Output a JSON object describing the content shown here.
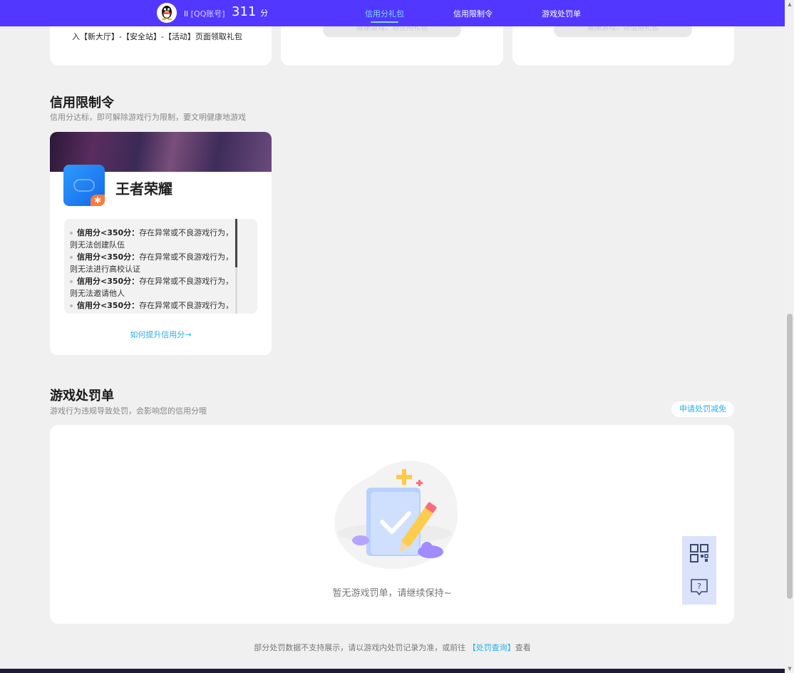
{
  "header": {
    "account_prefix": "ll",
    "account_label": "[QQ账号]",
    "score": "311",
    "score_unit": "分",
    "nav": [
      {
        "label": "信用分礼包",
        "active": true
      },
      {
        "label": "信用限制令",
        "active": false
      },
      {
        "label": "游戏处罚单",
        "active": false
      }
    ]
  },
  "top_cards": {
    "card1_text": "入【新大厅】-【安全站】-【活动】页面领取礼包",
    "card2_button": "健康游戏，领信用礼包",
    "card3_button": "健康游戏，领信用礼包"
  },
  "restriction": {
    "title": "信用限制令",
    "subtitle": "信用分达标，即可解除游戏行为限制，要文明健康地游戏",
    "game_name": "王者荣耀",
    "rules": [
      {
        "bold": "信用分<350分：",
        "text": "存在异常或不良游戏行为，则无法创建队伍"
      },
      {
        "bold": "信用分<350分：",
        "text": "存在异常或不良游戏行为，则无法进行高校认证"
      },
      {
        "bold": "信用分<350分：",
        "text": "存在异常或不良游戏行为，则无法邀请他人"
      },
      {
        "bold": "信用分<350分：",
        "text": "存在异常或不良游戏行为，"
      }
    ],
    "howto_link": "如何提升信用分→"
  },
  "penalty": {
    "title": "游戏处罚单",
    "subtitle": "游戏行为违规导致处罚，会影响您的信用分哦",
    "appeal_button": "申请处罚减免",
    "empty_text": "暂无游戏罚单，请继续保持~"
  },
  "footer": {
    "note_prefix": "部分处罚数据不支持展示，请以游戏内处罚记录为准，或前往",
    "note_link": "【处罚查询】",
    "note_suffix": "查看"
  },
  "float_buttons": {
    "qr_icon": "qr-code-icon",
    "help_icon": "help-chat-icon"
  },
  "colors": {
    "brand": "#5137ff",
    "link": "#2ab0e8",
    "background": "#f0f0f0"
  }
}
